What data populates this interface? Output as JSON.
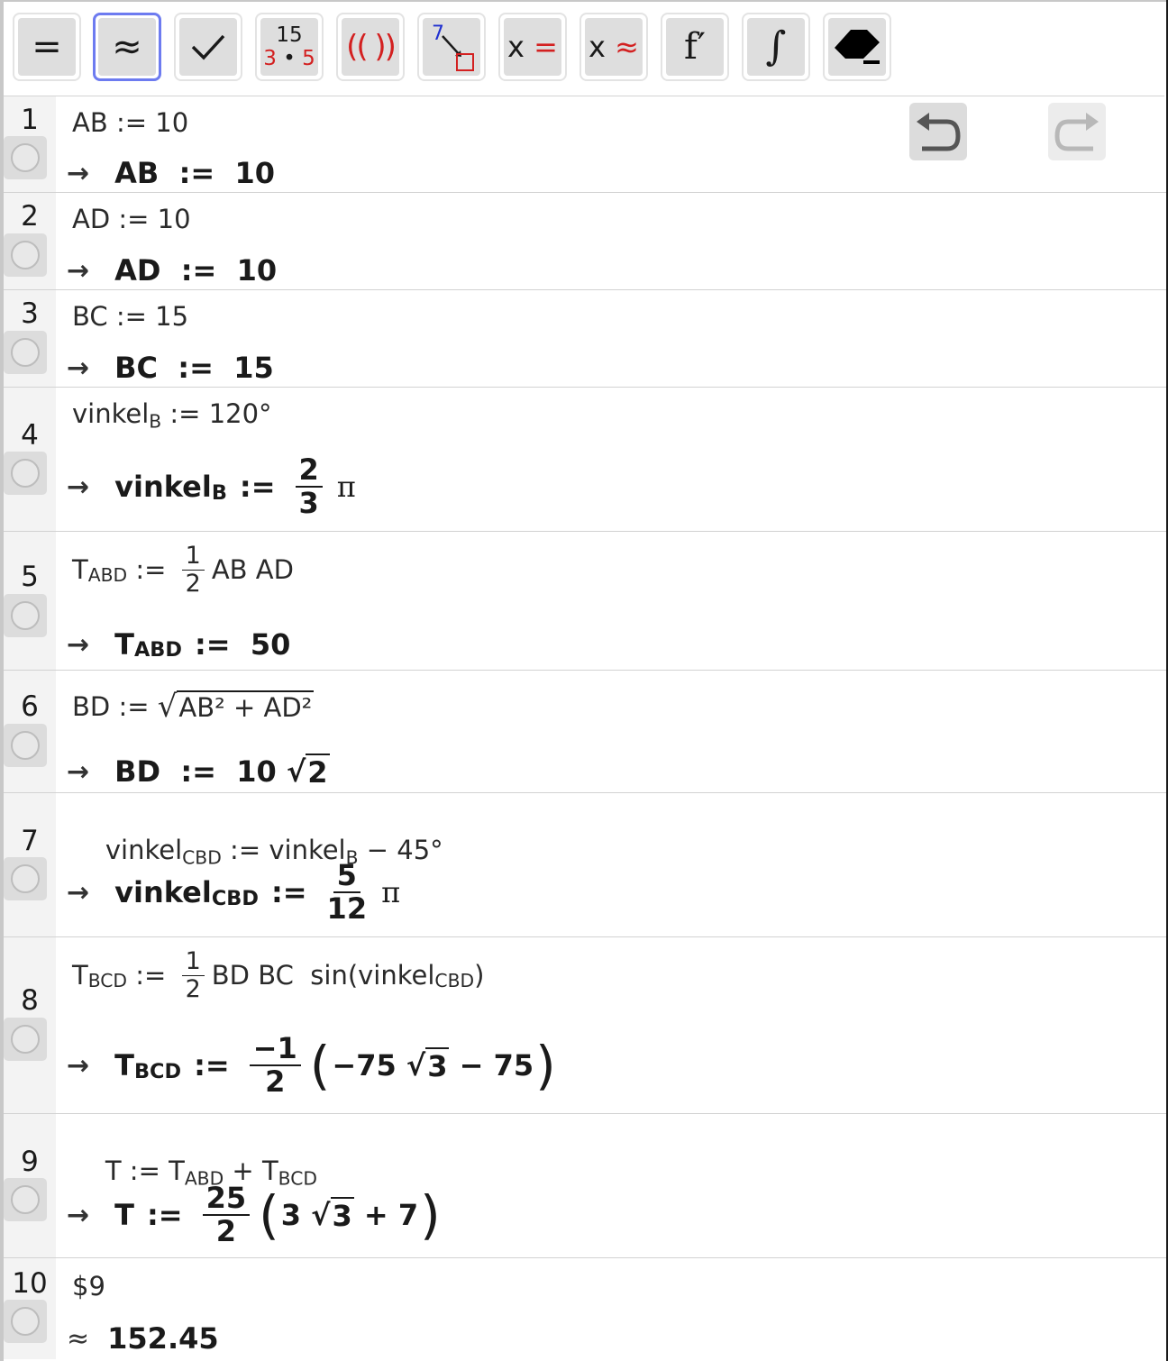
{
  "toolbar": {
    "buttons": [
      {
        "id": "evaluate",
        "label": "="
      },
      {
        "id": "numeric",
        "label": "≈"
      },
      {
        "id": "keep-input",
        "label": "✓"
      },
      {
        "id": "factor",
        "top": "15",
        "bottom_a": "3",
        "bottom_dot": "•",
        "bottom_b": "5"
      },
      {
        "id": "expand",
        "label": "(( ))"
      },
      {
        "id": "substitute",
        "label": "7"
      },
      {
        "id": "solve",
        "x": "x",
        "op": "="
      },
      {
        "id": "solve-numeric",
        "x": "x",
        "op": "≈"
      },
      {
        "id": "derivative",
        "label": "f′"
      },
      {
        "id": "integral",
        "label": "∫"
      },
      {
        "id": "delete",
        "label": "eraser"
      }
    ]
  },
  "rows": [
    {
      "num": "1",
      "input": "AB := 10",
      "output": "AB  :=  10"
    },
    {
      "num": "2",
      "input": "AD := 10",
      "output": "AD  :=  10"
    },
    {
      "num": "3",
      "input": "BC := 15",
      "output": "BC  :=  15"
    },
    {
      "num": "4",
      "input_a": "vinkel",
      "input_sub": "B",
      "input_b": " := 120°",
      "out_a": "vinkel",
      "out_sub": "B",
      "out_op": ":=",
      "frac_num": "2",
      "frac_den": "3",
      "out_b": "π"
    },
    {
      "num": "5",
      "in_a": "T",
      "in_sub": "ABD",
      "in_op": " := ",
      "frac_num": "1",
      "frac_den": "2",
      "in_b": "AB AD",
      "out_a": "T",
      "out_sub": "ABD",
      "out_b": ":=  50"
    },
    {
      "num": "6",
      "in_a": "BD := ",
      "in_sqrt": "AB² + AD²",
      "out_a": "BD  :=  10 ",
      "out_sqrt": "2"
    },
    {
      "num": "7",
      "in_a": "vinkel",
      "in_sub": "CBD",
      "in_b": " := vinkel",
      "in_sub2": "B",
      "in_c": " − 45°",
      "out_a": "vinkel",
      "out_sub": "CBD",
      "out_op": ":=",
      "frac_num": "5",
      "frac_den": "12",
      "out_b": "π"
    },
    {
      "num": "8",
      "in_a": "T",
      "in_sub": "BCD",
      "in_op": " := ",
      "frac_num": "1",
      "frac_den": "2",
      "in_b": "BD BC  sin(vinkel",
      "in_sub2": "CBD",
      "in_c": ")",
      "out_a": "T",
      "out_sub": "BCD",
      "out_op": ":=",
      "out_frac_num": "−1",
      "out_frac_den": "2",
      "out_lp": "(",
      "out_b": "−75 ",
      "out_sqrt": "3",
      "out_c": " − 75",
      "out_rp": ")"
    },
    {
      "num": "9",
      "in_a": "T := T",
      "in_sub": "ABD",
      "in_b": " + T",
      "in_sub2": "BCD",
      "out_a": "T",
      "out_op": ":=",
      "out_frac_num": "25",
      "out_frac_den": "2",
      "out_lp": "(",
      "out_b": "3 ",
      "out_sqrt": "3",
      "out_c": " + 7",
      "out_rp": ")"
    },
    {
      "num": "10",
      "input": "$9",
      "output": "152.45"
    }
  ],
  "arrow": "→",
  "approx_symbol": "≈"
}
